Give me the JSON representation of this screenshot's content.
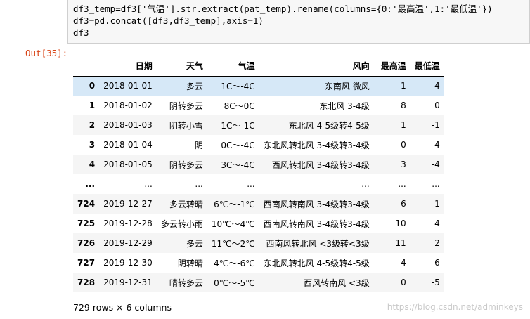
{
  "code": {
    "lines": [
      "",
      "df3_temp=df3['气温'].str.extract(pat_temp).rename(columns={0:'最高温',1:'最低温'})",
      "df3=pd.concat([df3,df3_temp],axis=1)",
      "df3"
    ]
  },
  "output": {
    "prompt": "Out[35]:",
    "headers": [
      "",
      "日期",
      "天气",
      "气温",
      "风向",
      "最高温",
      "最低温"
    ],
    "rows": [
      [
        "0",
        "2018-01-01",
        "多云",
        "1C～-4C",
        "东南风 微风",
        "1",
        "-4"
      ],
      [
        "1",
        "2018-01-02",
        "阴转多云",
        "8C～0C",
        "东北风 3-4级",
        "8",
        "0"
      ],
      [
        "2",
        "2018-01-03",
        "阴转小雪",
        "1C～-1C",
        "东北风 4-5级转4-5级",
        "1",
        "-1"
      ],
      [
        "3",
        "2018-01-04",
        "阴",
        "0C～-4C",
        "东北风转北风 3-4级转3-4级",
        "0",
        "-4"
      ],
      [
        "4",
        "2018-01-05",
        "阴转多云",
        "3C～-4C",
        "西风转北风 3-4级转3-4级",
        "3",
        "-4"
      ],
      [
        "...",
        "...",
        "...",
        "...",
        "...",
        "...",
        "..."
      ],
      [
        "724",
        "2019-12-27",
        "多云转晴",
        "6℃～-1℃",
        "西南风转南风 3-4级转3-4级",
        "6",
        "-1"
      ],
      [
        "725",
        "2019-12-28",
        "多云转小雨",
        "10℃～4℃",
        "西南风转南风 3-4级转3-4级",
        "10",
        "4"
      ],
      [
        "726",
        "2019-12-29",
        "多云",
        "11℃～2℃",
        "西南风转北风 <3级转<3级",
        "11",
        "2"
      ],
      [
        "727",
        "2019-12-30",
        "阴转晴",
        "4℃～-6℃",
        "东北风转北风 4-5级转4-5级",
        "4",
        "-6"
      ],
      [
        "728",
        "2019-12-31",
        "晴转多云",
        "0℃～-5℃",
        "西风转南风 <3级",
        "0",
        "-5"
      ]
    ],
    "summary": "729 rows × 6 columns"
  },
  "watermark": "https://blog.csdn.net/adminkeys"
}
